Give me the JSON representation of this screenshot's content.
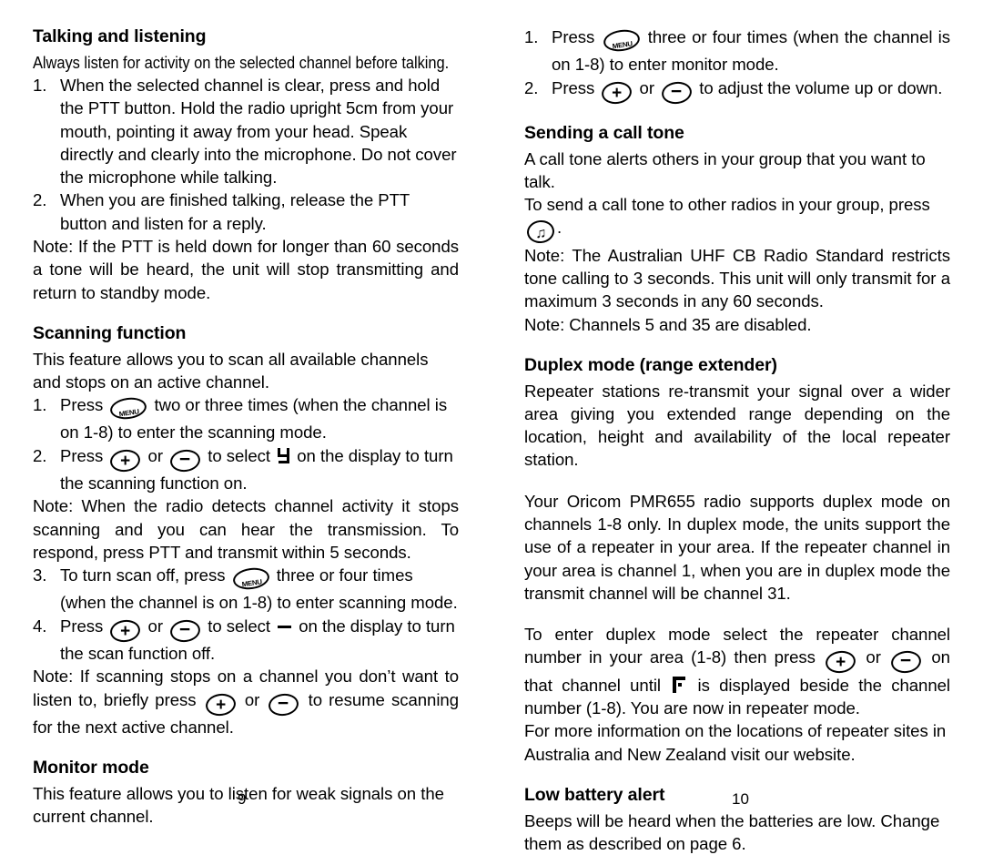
{
  "document": {
    "type": "two-column product manual spread",
    "page_numbers": {
      "left": "9",
      "right": "10"
    }
  },
  "left_column": {
    "heading_1": "Talking and listening",
    "lead_1": "Always listen for activity on the selected channel before talking.",
    "list_1": [
      {
        "num": "1.",
        "text": "When the selected channel is clear, press and hold the PTT button. Hold the radio upright 5cm from your mouth, pointing it away from your head. Speak directly and clearly into the microphone. Do not cover the microphone while talking."
      },
      {
        "num": "2.",
        "text": "When you are finished talking, release the PTT button and listen for a reply."
      }
    ],
    "note_1": "Note: If the PTT is held down for longer than 60 seconds a tone will be heard, the unit will stop transmitting and return to standby mode.",
    "heading_2": "Scanning function",
    "para_2": "This feature allows you to scan all available channels and stops on an active channel.",
    "step_2_1": {
      "num": "1.",
      "before": "Press",
      "icon": "menu-button-icon",
      "icon_label": "MENU",
      "after": "two or three times (when the channel is on 1-8) to enter the scanning mode."
    },
    "step_2_2": {
      "num": "2.",
      "before": "Press",
      "icon_plus": "plus-button-icon",
      "plus_glyph": "+",
      "conjunction": "or",
      "icon_minus": "minus-button-icon",
      "minus_glyph": "−",
      "middle": "to select",
      "display_symbol": "scan-on-lcd-icon",
      "after": "on the display to turn the scanning function on."
    },
    "note_2": "Note: When the radio detects channel activity it stops scanning and you can hear the transmission. To respond, press PTT and transmit within 5 seconds.",
    "step_2_3": {
      "num": "3.",
      "before": "To turn scan off, press",
      "icon": "menu-button-icon",
      "icon_label": "MENU",
      "after": "three or four times (when the channel is on 1-8) to enter scanning mode."
    },
    "step_2_4": {
      "num": "4.",
      "before": "Press",
      "plus_glyph": "+",
      "conjunction": "or",
      "minus_glyph": "−",
      "middle": "to select",
      "display_symbol": "scan-off-lcd-icon",
      "after": "on the display to turn the scan function off."
    },
    "note_3": {
      "before": "Note: If scanning stops on a channel you don’t want to listen to, briefly press",
      "plus_glyph": "+",
      "conjunction": "or",
      "minus_glyph": "−",
      "after": "to resume scanning for the next active channel."
    },
    "heading_3": "Monitor mode",
    "para_3": "This feature allows you to listen for weak signals on the current channel."
  },
  "right_column": {
    "step_1": {
      "num": "1.",
      "before": "Press",
      "icon": "menu-button-icon",
      "icon_label": "MENU",
      "after": "three or four times (when the channel is on 1-8) to enter monitor mode."
    },
    "step_2": {
      "num": "2.",
      "before": "Press",
      "plus_glyph": "+",
      "conjunction": "or",
      "minus_glyph": "−",
      "after": "to adjust the volume up or down."
    },
    "heading_1": "Sending a call tone",
    "para_1a": "A call tone alerts others in your group that you want to talk.",
    "para_1b": {
      "before": "To send a call tone to other radios in your group, press",
      "icon": "call-tone-button-icon",
      "icon_glyph": "♫",
      "after": "."
    },
    "note_1": "Note: The Australian UHF CB Radio Standard restricts tone calling to 3 seconds. This unit will only transmit for a maximum 3 seconds in any 60 seconds.",
    "note_2": "Note: Channels 5 and 35 are disabled.",
    "heading_2": "Duplex mode (range extender)",
    "para_2": "Repeater stations re-transmit your signal over a wider area giving you extended range depending on the location, height and availability of the local repeater station.",
    "para_3": "Your Oricom PMR655 radio supports duplex mode on channels 1-8 only. In duplex mode, the units support the use of a repeater in your area. If the repeater channel in your area is channel 1, when you are in duplex mode the transmit channel will be channel 31.",
    "para_4": {
      "before": "To enter duplex mode select the repeater channel number in your area (1-8) then press",
      "plus_glyph": "+",
      "conjunction": "or",
      "middle": "on that channel until",
      "minus_glyph": "−",
      "display_symbol": "repeater-lcd-icon",
      "after": "is displayed beside the channel number (1-8). You are now in repeater mode."
    },
    "para_5": "For more information on the locations of repeater sites in Australia and New Zealand visit our website.",
    "heading_3": "Low battery alert",
    "para_6": "Beeps will be heard when the batteries are low. Change them as described on page 6."
  }
}
